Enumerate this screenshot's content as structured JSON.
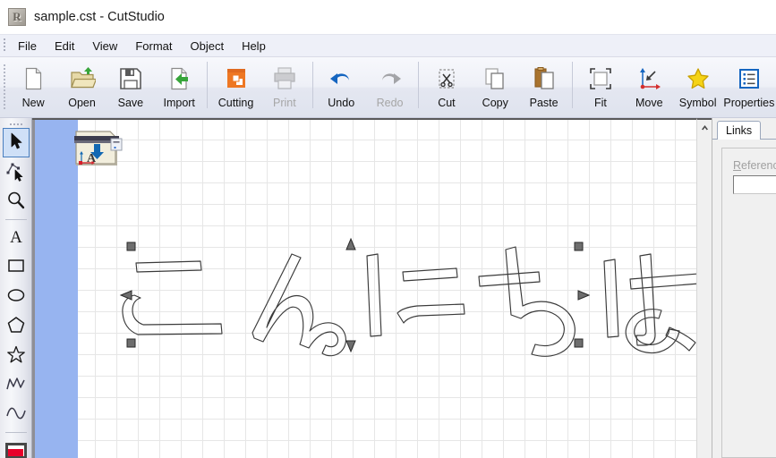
{
  "window": {
    "title": "sample.cst - CutStudio",
    "app_icon": "roland-app-icon",
    "document_name": "sample.cst",
    "app_name": "CutStudio"
  },
  "menubar": {
    "items": [
      {
        "label": "File"
      },
      {
        "label": "Edit"
      },
      {
        "label": "View"
      },
      {
        "label": "Format"
      },
      {
        "label": "Object"
      },
      {
        "label": "Help"
      }
    ]
  },
  "toolbar": {
    "buttons": [
      {
        "label": "New",
        "icon": "new-document-icon",
        "enabled": true
      },
      {
        "label": "Open",
        "icon": "open-folder-icon",
        "enabled": true
      },
      {
        "label": "Save",
        "icon": "floppy-disk-icon",
        "enabled": true
      },
      {
        "label": "Import",
        "icon": "import-arrow-icon",
        "enabled": true
      },
      {
        "label": "Cutting",
        "icon": "cutting-plotter-icon",
        "enabled": true
      },
      {
        "label": "Print",
        "icon": "printer-icon",
        "enabled": false
      },
      {
        "label": "Undo",
        "icon": "undo-arrow-icon",
        "enabled": true
      },
      {
        "label": "Redo",
        "icon": "redo-arrow-icon",
        "enabled": false
      },
      {
        "label": "Cut",
        "icon": "scissors-icon",
        "enabled": true
      },
      {
        "label": "Copy",
        "icon": "copy-pages-icon",
        "enabled": true
      },
      {
        "label": "Paste",
        "icon": "clipboard-icon",
        "enabled": true
      },
      {
        "label": "Fit",
        "icon": "fit-frame-icon",
        "enabled": true
      },
      {
        "label": "Move",
        "icon": "move-axes-icon",
        "enabled": true
      },
      {
        "label": "Symbol",
        "icon": "star-symbol-icon",
        "enabled": true
      },
      {
        "label": "Properties",
        "icon": "properties-list-icon",
        "enabled": true
      }
    ]
  },
  "palette": {
    "tools": [
      {
        "name": "select-arrow-tool",
        "icon": "arrow-cursor-icon",
        "selected": true
      },
      {
        "name": "node-edit-tool",
        "icon": "node-edit-icon",
        "selected": false
      },
      {
        "name": "zoom-tool",
        "icon": "magnifier-icon",
        "selected": false
      },
      {
        "name": "text-tool",
        "icon": "letter-a-icon",
        "selected": false
      },
      {
        "name": "rectangle-tool",
        "icon": "rectangle-icon",
        "selected": false
      },
      {
        "name": "ellipse-tool",
        "icon": "ellipse-icon",
        "selected": false
      },
      {
        "name": "polygon-tool",
        "icon": "pentagon-icon",
        "selected": false
      },
      {
        "name": "star-tool",
        "icon": "star-outline-icon",
        "selected": false
      },
      {
        "name": "polyline-tool",
        "icon": "polyline-icon",
        "selected": false
      },
      {
        "name": "curve-tool",
        "icon": "curve-icon",
        "selected": false
      }
    ],
    "color_swatch": "#e8002a"
  },
  "canvas": {
    "grid_visible": true,
    "grid_spacing_px": 24,
    "material_strip_color": "#97b4f0",
    "machine_icon": "machine-setup-icon",
    "object": {
      "type": "text-outline",
      "text": "こんにちは",
      "characters": [
        "こ",
        "ん",
        "に",
        "ち",
        "は"
      ],
      "selected": true,
      "stroke_color": "#3a3a3a",
      "fill": "none"
    },
    "selection_handles": [
      "handle-top-left",
      "handle-top-center",
      "handle-top-right",
      "handle-middle-left",
      "handle-middle-right",
      "handle-bottom-left",
      "handle-bottom-center",
      "handle-bottom-right"
    ]
  },
  "scrollbar": {
    "up_arrow": "scroll-up-icon"
  },
  "right_panel": {
    "tabs": [
      {
        "label": "Links",
        "active": true
      }
    ],
    "reference_label_prefix": "R",
    "reference_label_rest": "eference",
    "reference_value": "",
    "reference_placeholder": ""
  }
}
